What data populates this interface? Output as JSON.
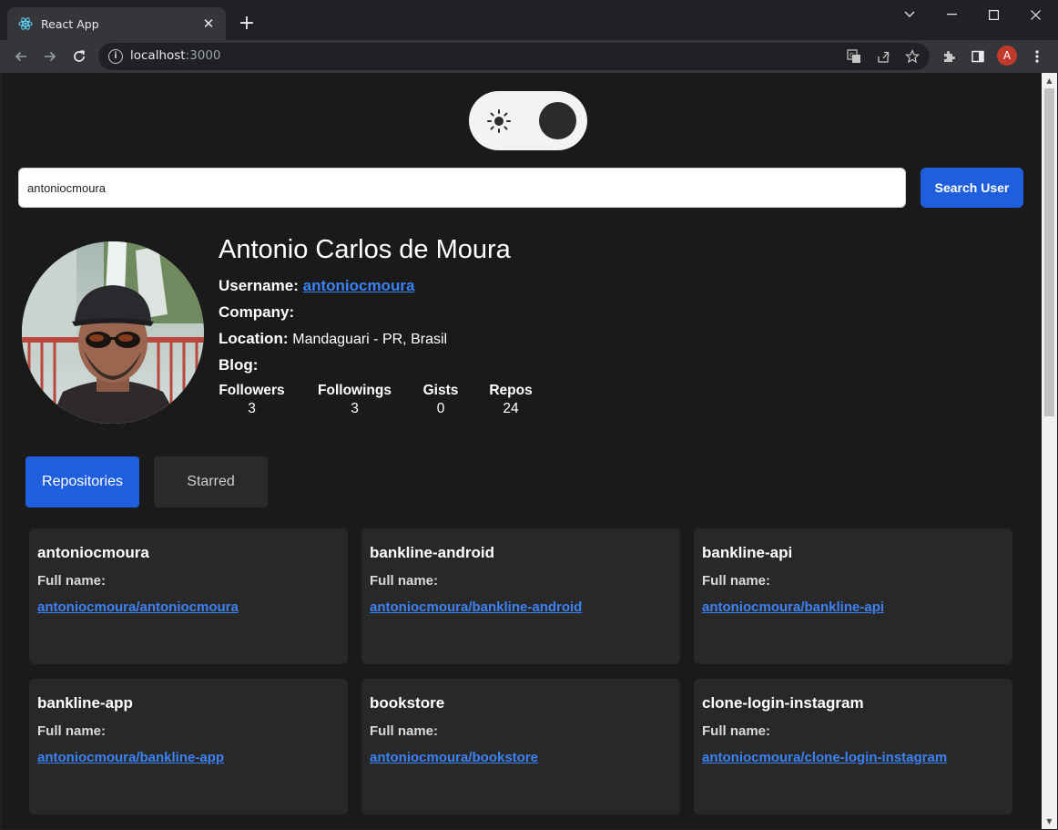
{
  "browser": {
    "tab_title": "React App",
    "tab_close": "✕",
    "new_tab": "+",
    "url_host": "localhost",
    "url_port": ":3000",
    "profile_initial": "A"
  },
  "app": {
    "search": {
      "value": "antoniocmoura",
      "button_label": "Search User"
    },
    "profile": {
      "name": "Antonio Carlos de Moura",
      "username_label": "Username:",
      "username_value": "antoniocmoura",
      "company_label": "Company:",
      "company_value": "",
      "location_label": "Location:",
      "location_value": "Mandaguari - PR, Brasil",
      "blog_label": "Blog:",
      "blog_value": "",
      "stats": [
        {
          "label": "Followers",
          "value": "3"
        },
        {
          "label": "Followings",
          "value": "3"
        },
        {
          "label": "Gists",
          "value": "0"
        },
        {
          "label": "Repos",
          "value": "24"
        }
      ]
    },
    "tabs": {
      "repositories": "Repositories",
      "starred": "Starred"
    },
    "full_name_label": "Full name:",
    "repos": [
      {
        "name": "antoniocmoura",
        "full_name": "antoniocmoura/antoniocmoura"
      },
      {
        "name": "bankline-android",
        "full_name": "antoniocmoura/bankline-android"
      },
      {
        "name": "bankline-api",
        "full_name": "antoniocmoura/bankline-api"
      },
      {
        "name": "bankline-app",
        "full_name": "antoniocmoura/bankline-app"
      },
      {
        "name": "bookstore",
        "full_name": "antoniocmoura/bookstore"
      },
      {
        "name": "clone-login-instagram",
        "full_name": "antoniocmoura/clone-login-instagram"
      }
    ]
  },
  "colors": {
    "accent": "#1f5fde",
    "link": "#3b82f6",
    "card": "#282828",
    "page_bg": "#1a1a1a"
  }
}
